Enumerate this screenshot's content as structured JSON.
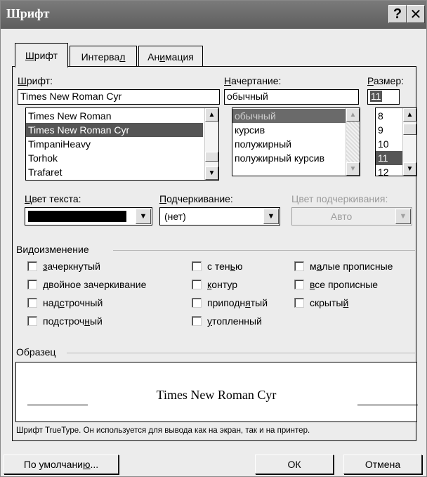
{
  "window": {
    "title": "Шрифт",
    "help_glyph": "?",
    "close_glyph": "✕"
  },
  "tabs": [
    {
      "pre": "",
      "acc": "Ш",
      "post": "рифт"
    },
    {
      "pre": "Интерва",
      "acc": "л",
      "post": ""
    },
    {
      "pre": "Ан",
      "acc": "и",
      "post": "мация"
    }
  ],
  "font": {
    "label_acc": "Ш",
    "label_rest": "рифт:",
    "value": "Times New Roman Cyr",
    "items": [
      "Times New Roman",
      "Times New Roman Cyr",
      "TimpaniHeavy",
      "Torhok",
      "Trafaret"
    ],
    "selected_index": 1
  },
  "style": {
    "label_acc": "Н",
    "label_rest": "ачертание:",
    "value": "обычный",
    "items": [
      "обычный",
      "курсив",
      "полужирный",
      "полужирный курсив"
    ],
    "selected_index": 0
  },
  "size": {
    "label_acc": "Р",
    "label_rest": "азмер:",
    "value": "11",
    "items": [
      "8",
      "9",
      "10",
      "11",
      "12"
    ],
    "selected_index": 3
  },
  "color": {
    "label_acc": "Ц",
    "label_rest": "вет текста:",
    "value_color": "#000000"
  },
  "underline": {
    "label_acc": "П",
    "label_rest": "одчеркивание:",
    "value": "(нет)"
  },
  "underline_color": {
    "label": "Цвет подчеркивания:",
    "value": "Авто"
  },
  "effects": {
    "title": "Видоизменение",
    "col1": [
      {
        "pre": "",
        "acc": "з",
        "post": "ачеркнутый"
      },
      {
        "pre": "",
        "acc": "д",
        "post": "войное зачеркивание"
      },
      {
        "pre": "над",
        "acc": "с",
        "post": "трочный"
      },
      {
        "pre": "подстроч",
        "acc": "н",
        "post": "ый"
      }
    ],
    "col2": [
      {
        "pre": "с тен",
        "acc": "ь",
        "post": "ю"
      },
      {
        "pre": "",
        "acc": "к",
        "post": "онтур"
      },
      {
        "pre": "приподн",
        "acc": "я",
        "post": "тый"
      },
      {
        "pre": "",
        "acc": "у",
        "post": "топленный"
      }
    ],
    "col3": [
      {
        "pre": "м",
        "acc": "а",
        "post": "лые прописные"
      },
      {
        "pre": "",
        "acc": "в",
        "post": "се прописные"
      },
      {
        "pre": "скрыты",
        "acc": "й",
        "post": ""
      }
    ]
  },
  "sample": {
    "title": "Образец",
    "text": "Times New Roman Cyr",
    "note": "Шрифт TrueType. Он используется для вывода как на экран, так и на принтер."
  },
  "buttons": {
    "default_pre": "По умолчани",
    "default_acc": "ю",
    "default_post": "...",
    "ok": "ОК",
    "cancel": "Отмена"
  }
}
